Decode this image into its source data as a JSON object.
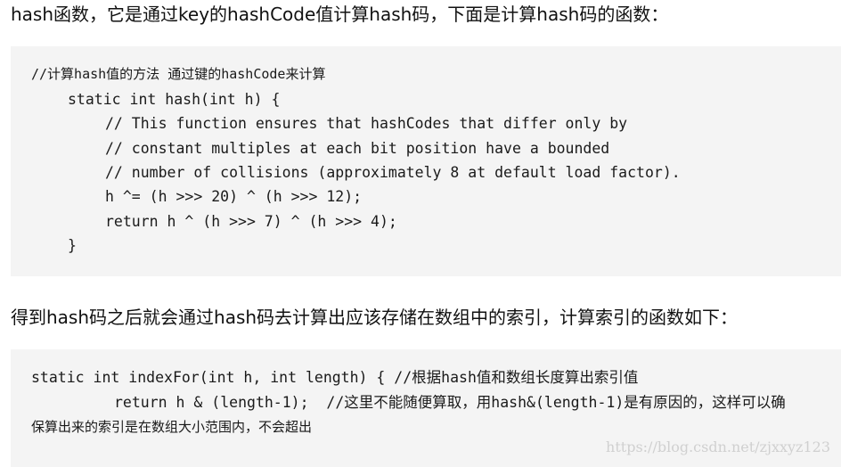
{
  "paragraph1": "hash函数，它是通过key的hashCode值计算hash码，下面是计算hash码的函数：",
  "code1": {
    "comment": "//计算hash值的方法 通过键的hashCode来计算",
    "lines": [
      "static int hash(int h) {",
      "// This function ensures that hashCodes that differ only by",
      "// constant multiples at each bit position have a bounded",
      "// number of collisions (approximately 8 at default load factor).",
      "h ^= (h >>> 20) ^ (h >>> 12);",
      "return h ^ (h >>> 7) ^ (h >>> 4);",
      "}"
    ]
  },
  "paragraph2": "得到hash码之后就会通过hash码去计算出应该存储在数组中的索引，计算索引的函数如下：",
  "code2": {
    "line1": "static int indexFor(int h, int length) { //根据hash值和数组长度算出索引值",
    "line2": "return h & (length-1);  //这里不能随便算取，用hash&(length-1)是有原因的，这样可以确",
    "line3": "保算出来的索引是在数组大小范围内，不会超出"
  },
  "watermark": "https://blog.csdn.net/zjxxyz123"
}
